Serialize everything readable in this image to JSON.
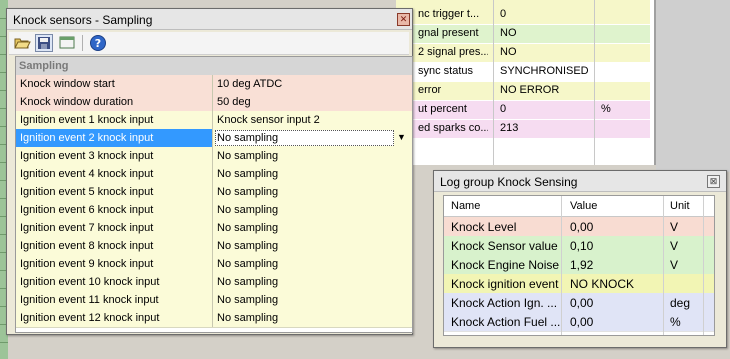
{
  "background_table": {
    "rows": [
      {
        "name": "nc trigger t...",
        "value": "0",
        "unit": "",
        "color": "#f6f7c9"
      },
      {
        "name": "gnal present",
        "value": "NO",
        "unit": "",
        "color": "#dff3cd"
      },
      {
        "name": "2 signal pres...",
        "value": "NO",
        "unit": "",
        "color": "#f6f7c9"
      },
      {
        "name": "sync status",
        "value": "SYNCHRONISED",
        "unit": "",
        "color": "#ffffff"
      },
      {
        "name": "error",
        "value": "NO ERROR",
        "unit": "",
        "color": "#f6f7c9"
      },
      {
        "name": "ut percent",
        "value": "0",
        "unit": "%",
        "color": "#f6dcf1"
      },
      {
        "name": "ed sparks co...",
        "value": "213",
        "unit": "",
        "color": "#f6dcf1"
      }
    ]
  },
  "knock_window": {
    "title": "Knock sensors - Sampling",
    "toolbar": [
      "open-folder-icon",
      "save-disk-icon",
      "window-icon",
      "help-icon"
    ],
    "section": "Sampling",
    "rows": [
      {
        "name": "Knock window start",
        "value": "10 deg ATDC",
        "color": "pink"
      },
      {
        "name": "Knock window duration",
        "value": "50 deg",
        "color": "pink"
      },
      {
        "name": "Ignition event 1 knock input",
        "value": "Knock sensor input 2",
        "color": "yellow"
      },
      {
        "name": "Ignition event 2 knock input",
        "value": "No sampling",
        "color": "yellow",
        "selected": true
      },
      {
        "name": "Ignition event 3 knock input",
        "value": "No sampling",
        "color": "yellow"
      },
      {
        "name": "Ignition event 4 knock input",
        "value": "No sampling",
        "color": "yellow"
      },
      {
        "name": "Ignition event 5 knock input",
        "value": "No sampling",
        "color": "yellow"
      },
      {
        "name": "Ignition event 6 knock input",
        "value": "No sampling",
        "color": "yellow"
      },
      {
        "name": "Ignition event 7 knock input",
        "value": "No sampling",
        "color": "yellow"
      },
      {
        "name": "Ignition event 8 knock input",
        "value": "No sampling",
        "color": "yellow"
      },
      {
        "name": "Ignition event 9 knock input",
        "value": "No sampling",
        "color": "yellow"
      },
      {
        "name": "Ignition event 10 knock input",
        "value": "No sampling",
        "color": "yellow"
      },
      {
        "name": "Ignition event 11 knock input",
        "value": "No sampling",
        "color": "yellow"
      },
      {
        "name": "Ignition event 12 knock input",
        "value": "No sampling",
        "color": "yellow"
      }
    ]
  },
  "log_window": {
    "title": "Log group Knock Sensing",
    "headers": {
      "name": "Name",
      "value": "Value",
      "unit": "Unit"
    },
    "rows": [
      {
        "name": "Knock Level",
        "value": "0,00",
        "unit": "V",
        "color": "#f8dcd2"
      },
      {
        "name": "Knock Sensor value",
        "value": "0,10",
        "unit": "V",
        "color": "#d8f2cc"
      },
      {
        "name": "Knock Engine Noise",
        "value": "1,92",
        "unit": "V",
        "color": "#d8f2cc"
      },
      {
        "name": "Knock ignition event",
        "value": "NO KNOCK",
        "unit": "",
        "color": "#f2f5b4"
      },
      {
        "name": "Knock Action Ign. ...",
        "value": "0,00",
        "unit": "deg",
        "color": "#e0e4f6"
      },
      {
        "name": "Knock Action Fuel ...",
        "value": "0,00",
        "unit": "%",
        "color": "#e0e4f6"
      }
    ]
  }
}
